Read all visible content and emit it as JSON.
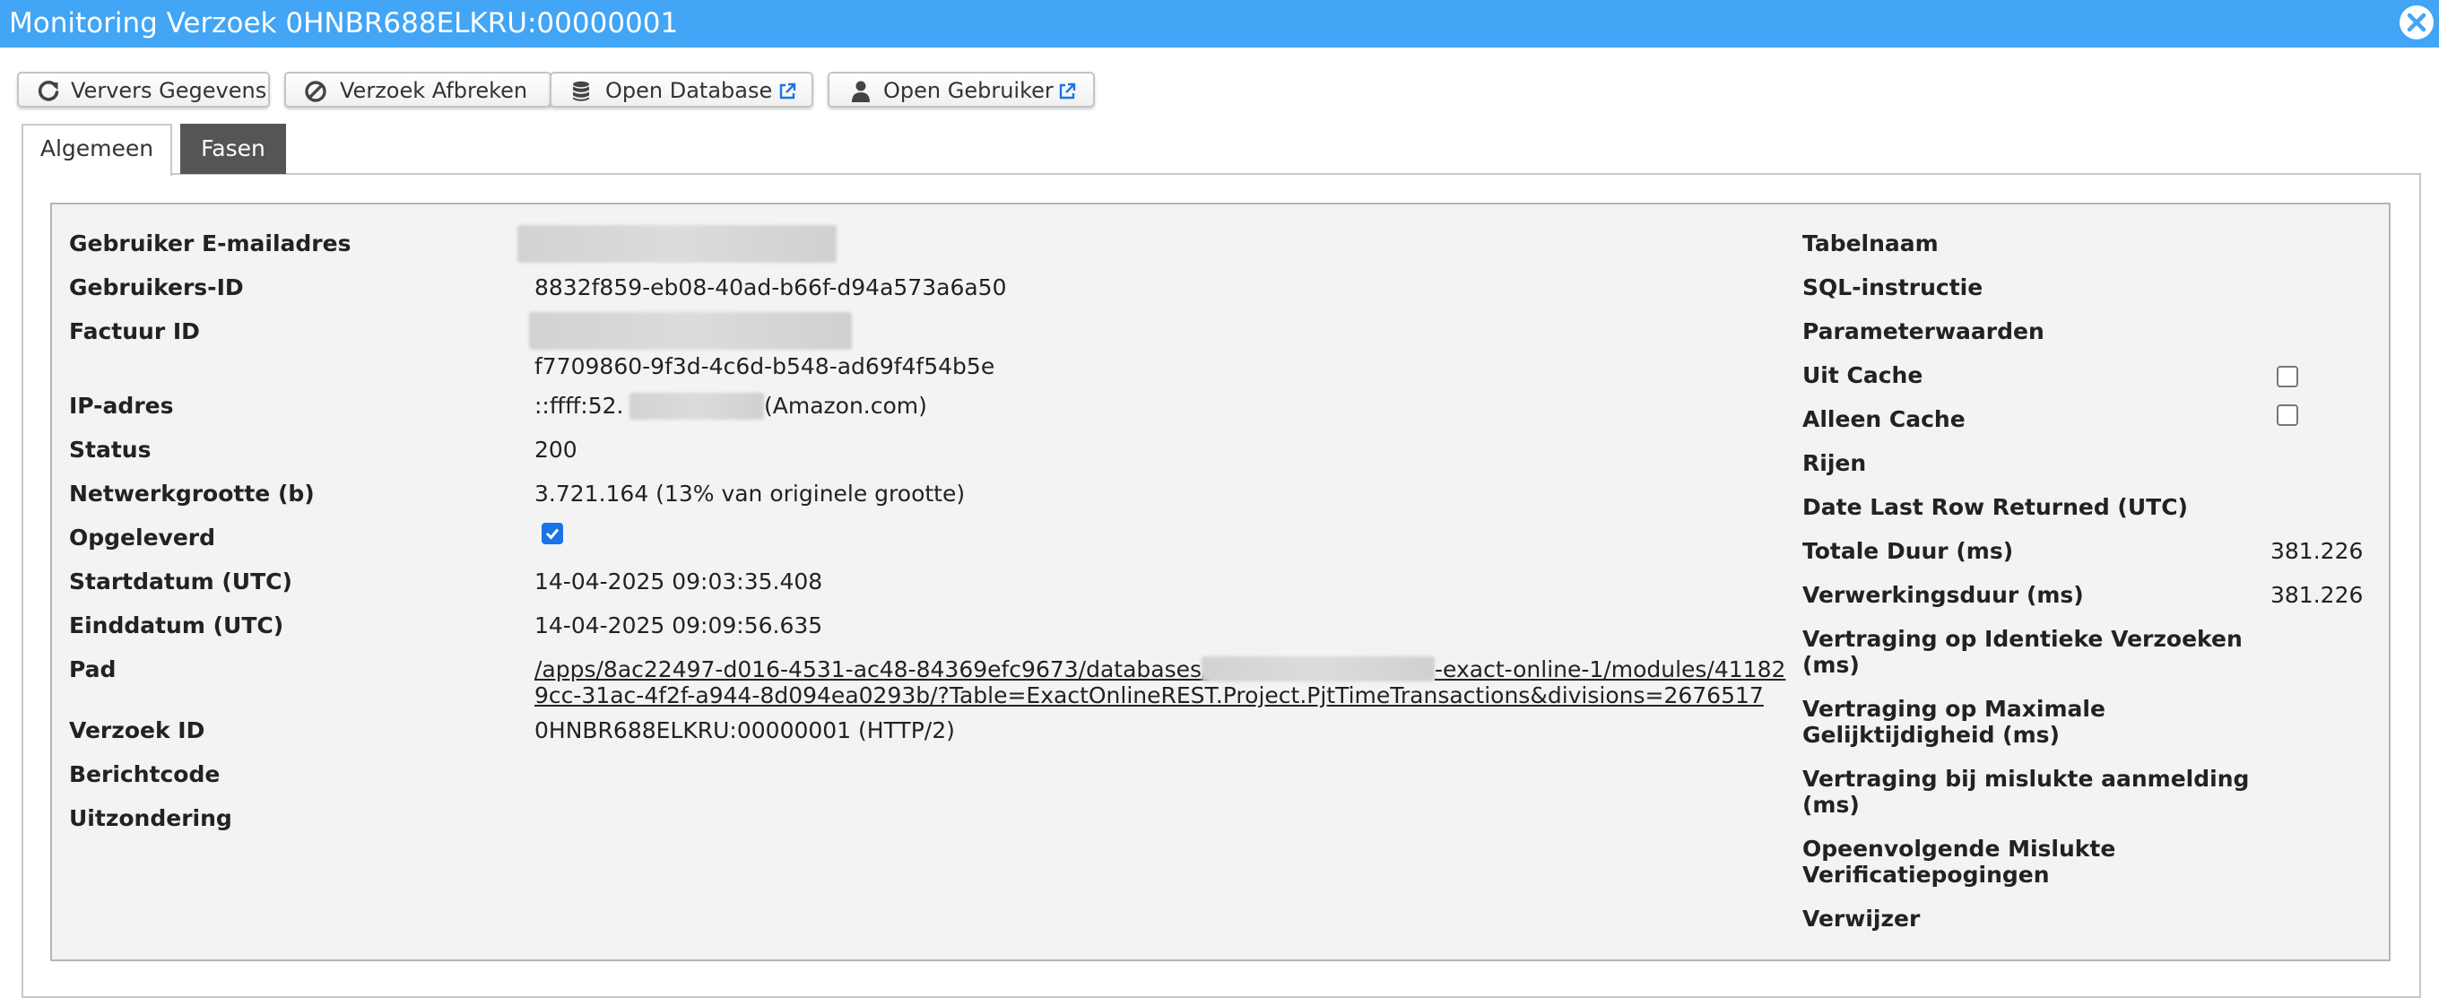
{
  "window": {
    "title": "Monitoring Verzoek 0HNBR688ELKRU:00000001"
  },
  "toolbar": {
    "refresh_label": "Ververs Gegevens",
    "abort_label": "Verzoek Afbreken",
    "open_database_label": "Open Database",
    "open_user_label": "Open Gebruiker"
  },
  "tabs": [
    {
      "label": "Algemeen",
      "active": true
    },
    {
      "label": "Fasen",
      "active": false
    }
  ],
  "left": {
    "email_label": "Gebruiker E-mailadres",
    "user_id_label": "Gebruikers-ID",
    "user_id_value": "8832f859-eb08-40ad-b66f-d94a573a6a50",
    "invoice_label": "Factuur ID",
    "invoice_value": "f7709860-9f3d-4c6d-b548-ad69f4f54b5e",
    "ip_label": "IP-adres",
    "ip_prefix": "::ffff:52.",
    "ip_suffix": "(Amazon.com)",
    "status_label": "Status",
    "status_value": "200",
    "netsize_label": "Netwerkgrootte (b)",
    "netsize_value": "3.721.164 (13% van originele grootte)",
    "delivered_label": "Opgeleverd",
    "delivered_checked": true,
    "start_label": "Startdatum (UTC)",
    "start_value": "14-04-2025 09:03:35.408",
    "end_label": "Einddatum (UTC)",
    "end_value": "14-04-2025 09:09:56.635",
    "path_label": "Pad",
    "path_line1_a": "/apps/8ac22497-d016-4531-ac48-84369efc9673/databases/",
    "path_line1_b": "-exact-online-1/modules/41182",
    "path_line2": "9cc-31ac-4f2f-a944-8d094ea0293b/?Table=ExactOnlineREST.Project.PjtTimeTransactions&divisions=2676517",
    "request_id_label": "Verzoek ID",
    "request_id_value": "0HNBR688ELKRU:00000001 (HTTP/2)",
    "message_label": "Berichtcode",
    "exception_label": "Uitzondering"
  },
  "right": {
    "table_label": "Tabelnaam",
    "sql_label": "SQL-instructie",
    "params_label": "Parameterwaarden",
    "from_cache_label": "Uit Cache",
    "from_cache_checked": false,
    "only_cache_label": "Alleen Cache",
    "only_cache_checked": false,
    "rows_label": "Rijen",
    "last_row_label": "Date Last Row Returned (UTC)",
    "total_label": "Totale Duur (ms)",
    "total_value": "381.226",
    "processing_label": "Verwerkingsduur (ms)",
    "processing_value": "381.226",
    "delay_identical_label_1": "Vertraging op Identieke Verzoeken",
    "delay_identical_label_2": "(ms)",
    "delay_concurrency_label_1": "Vertraging op Maximale",
    "delay_concurrency_label_2": "Gelijktijdigheid (ms)",
    "delay_login_label_1": "Vertraging bij mislukte aanmelding",
    "delay_login_label_2": "(ms)",
    "failed_attempts_label_1": "Opeenvolgende Mislukte",
    "failed_attempts_label_2": "Verificatiepogingen",
    "referrer_label": "Verwijzer"
  }
}
